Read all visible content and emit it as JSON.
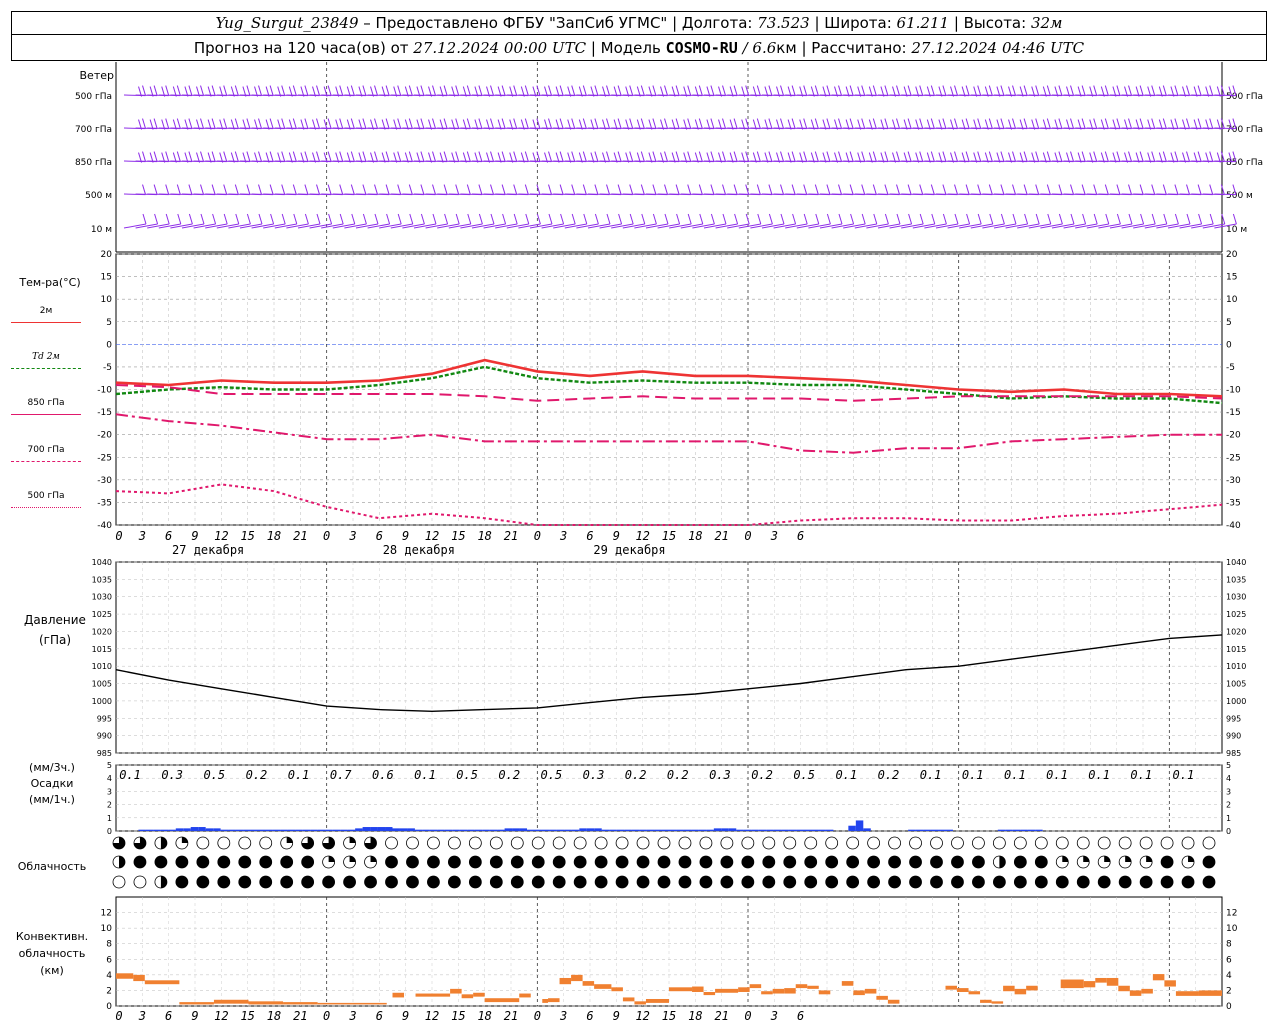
{
  "header": {
    "station": "Yug_Surgut_23849",
    "provider": " – Предоставлено ФГБУ \"ЗапСиб УГМС\" | Долгота: ",
    "lon": "73.523",
    "lat_label": " | Широта: ",
    "lat": "61.211",
    "height_label": " | Высота: ",
    "height": "32м",
    "forecast_label": "Прогноз на 120 часа(ов) от ",
    "forecast_time": "27.12.2024 00:00 UTC",
    "model_label": " | Модель ",
    "model": "COSMO-RU",
    "res": " / 6.6",
    "res_unit": "км",
    "computed_label": " | Рассчитано: ",
    "computed_time": "27.12.2024 04:46 UTC"
  },
  "labels": {
    "wind": "Ветер",
    "wind_levels": [
      "500 гПа",
      "700 гПа",
      "850 гПа",
      "500 м",
      "10 м"
    ],
    "temp": "Тем-ра(°С)",
    "legend": [
      "2м",
      "Td 2м",
      "850 гПа",
      "700 гПа",
      "500 гПа"
    ],
    "pressure": "Давление",
    "pressure_unit": "(гПа)",
    "precip_unit3": "(мм/3ч.)",
    "precip": "Осадки",
    "precip_unit1": "(мм/1ч.)",
    "cloud": "Облачность",
    "conv1": "Конвективн.",
    "conv2": "облачность",
    "conv_unit": "(км)"
  },
  "dates": [
    "27 декабря",
    "28 декабря",
    "29 декабря"
  ],
  "colors": {
    "t2m": "#ee3333",
    "td2m": "#118811",
    "t850": "#e0186c",
    "wind": "#8e2ee8",
    "precip": "#2244ee",
    "conv": "#f08030",
    "zero": "#4466ee"
  },
  "chart_data": [
    {
      "type": "line",
      "name": "temperature",
      "x_hours": [
        0,
        6,
        12,
        18,
        24,
        30,
        36,
        42,
        48,
        54,
        60,
        66,
        72,
        78,
        84,
        90,
        96,
        102,
        108,
        114,
        120,
        126
      ],
      "series": [
        {
          "name": "2м",
          "values": [
            -8.5,
            -9,
            -8,
            -8.5,
            -8.5,
            -8,
            -6.5,
            -3.5,
            -6,
            -7,
            -6,
            -7,
            -7,
            -7.5,
            -8,
            -9,
            -10,
            -10.5,
            -10,
            -11,
            -11,
            -11.5
          ]
        },
        {
          "name": "Td 2м",
          "values": [
            -11,
            -10,
            -9.5,
            -10,
            -10,
            -9,
            -7.5,
            -5,
            -7.5,
            -8.5,
            -8,
            -8.5,
            -8.5,
            -9,
            -9,
            -10,
            -11,
            -12,
            -11.5,
            -12,
            -12,
            -13
          ]
        },
        {
          "name": "850 гПа",
          "values": [
            -9,
            -9.5,
            -11,
            -11,
            -11,
            -11,
            -11,
            -11.5,
            -12.5,
            -12,
            -11.5,
            -12,
            -12,
            -12,
            -12.5,
            -12,
            -11.5,
            -11.5,
            -11.5,
            -11.5,
            -11.5,
            -12
          ]
        },
        {
          "name": "700 гПа",
          "values": [
            -15.5,
            -17,
            -18,
            -19.5,
            -21,
            -21,
            -20,
            -21.5,
            -21.5,
            -21.5,
            -21.5,
            -21.5,
            -21.5,
            -23.5,
            -24,
            -23,
            -23,
            -21.5,
            -21,
            -20.5,
            -20,
            -20
          ]
        },
        {
          "name": "500 гПа",
          "values": [
            -32.5,
            -33,
            -31,
            -32.5,
            -36,
            -38.5,
            -37.5,
            -38.5,
            -41,
            -42,
            -42,
            -42,
            -42,
            -39,
            -38.5,
            -38.5,
            -39,
            -39,
            -38,
            -37.5,
            -36.5,
            -35.5
          ]
        }
      ],
      "ylim": [
        -40,
        20
      ],
      "yticks": [
        -40,
        -35,
        -30,
        -25,
        -20,
        -15,
        -10,
        -5,
        0,
        5,
        10,
        15,
        20
      ]
    },
    {
      "type": "line",
      "name": "pressure",
      "x_hours": [
        0,
        6,
        12,
        18,
        24,
        30,
        36,
        42,
        48,
        54,
        60,
        66,
        72,
        78,
        84,
        90,
        96,
        102,
        108,
        114,
        120,
        126
      ],
      "values": [
        1009,
        1006,
        1003.5,
        1001,
        998.5,
        997.5,
        997,
        997.5,
        998,
        999.5,
        1001,
        1002,
        1003.5,
        1005,
        1007,
        1009,
        1010,
        1012,
        1014,
        1016,
        1018,
        1019
      ],
      "ylim": [
        985,
        1040
      ],
      "yticks": [
        985,
        990,
        995,
        1000,
        1005,
        1010,
        1015,
        1020,
        1025,
        1030,
        1035,
        1040
      ]
    },
    {
      "type": "bar",
      "name": "precipitation",
      "precip_3h": [
        "0.1",
        "0.3",
        "0.5",
        "0.2",
        "0.1",
        "0.7",
        "0.6",
        "0.1",
        "0.5",
        "0.2",
        "0.5",
        "0.3",
        "0.2",
        "0.2",
        "0.3",
        "0.2",
        "0.5",
        "0.1",
        "0.2",
        "0.1",
        "0.1",
        "0.1",
        "0.1",
        "0.1",
        "0.1",
        "0.1"
      ],
      "hourly": [
        0,
        0,
        0,
        0.1,
        0.1,
        0.1,
        0.1,
        0.1,
        0.2,
        0.2,
        0.3,
        0.3,
        0.2,
        0.2,
        0.1,
        0.1,
        0.1,
        0.1,
        0.1,
        0.1,
        0.1,
        0.1,
        0.1,
        0.1,
        0.1,
        0.1,
        0.1,
        0.1,
        0.1,
        0.1,
        0.1,
        0.1,
        0.2,
        0.3,
        0.3,
        0.3,
        0.3,
        0.2,
        0.2,
        0.2,
        0.1,
        0.1,
        0.1,
        0.1,
        0.1,
        0.1,
        0.1,
        0.1,
        0.1,
        0.1,
        0.1,
        0.1,
        0.2,
        0.2,
        0.2,
        0.1,
        0.1,
        0.1,
        0.1,
        0.1,
        0.1,
        0.1,
        0.2,
        0.2,
        0.2,
        0.1,
        0.1,
        0.1,
        0.1,
        0.1,
        0.1,
        0.1,
        0.1,
        0.1,
        0.1,
        0.1,
        0.1,
        0.1,
        0.1,
        0.1,
        0.2,
        0.2,
        0.2,
        0.1,
        0.1,
        0.1,
        0.1,
        0.1,
        0.1,
        0.1,
        0.1,
        0.1,
        0.1,
        0.1,
        0.1,
        0.1,
        0,
        0,
        0.4,
        0.8,
        0.2,
        0,
        0,
        0,
        0,
        0,
        0.1,
        0.1,
        0.1,
        0.1,
        0.1,
        0.1,
        0,
        0,
        0,
        0,
        0,
        0,
        0.1,
        0.1,
        0.1,
        0.1,
        0.1,
        0.1,
        0,
        0,
        0,
        0,
        0,
        0,
        0,
        0,
        0,
        0,
        0,
        0,
        0,
        0,
        0,
        0,
        0,
        0,
        0,
        0,
        0,
        0,
        0,
        0,
        0,
        0,
        0,
        0,
        0,
        0,
        0,
        0,
        0,
        0,
        0,
        0
      ],
      "ylim": [
        0,
        5
      ],
      "yticks": [
        0,
        1,
        2,
        3,
        4,
        5
      ]
    },
    {
      "type": "table",
      "name": "cloudiness",
      "rows": [
        [
          0.75,
          0.75,
          0.5,
          0.25,
          0,
          0,
          0,
          0,
          0.25,
          0.75,
          0.75,
          0.25,
          0.75,
          0,
          0,
          0,
          0,
          0,
          0,
          0,
          0,
          0,
          0,
          0,
          0,
          0,
          0,
          0,
          0,
          0,
          0,
          0,
          0,
          0,
          0,
          0,
          0,
          0,
          0,
          0,
          0,
          0,
          0,
          0,
          0,
          0,
          0,
          0,
          0,
          0,
          0,
          0,
          0,
          0,
          0,
          0,
          0,
          0,
          0,
          0,
          0,
          0,
          0,
          0,
          0,
          0,
          0,
          0,
          0,
          0,
          0,
          0,
          0,
          0,
          0,
          0,
          0,
          0,
          0,
          0,
          0,
          0,
          0,
          0
        ],
        [
          0.5,
          1,
          1,
          1,
          1,
          1,
          1,
          1,
          1,
          1,
          0.25,
          0.25,
          0.25,
          1,
          1,
          1,
          1,
          1,
          1,
          1,
          1,
          1,
          1,
          1,
          1,
          1,
          1,
          1,
          1,
          1,
          1,
          1,
          1,
          1,
          1,
          1,
          1,
          1,
          1,
          1,
          1,
          1,
          0.5,
          1,
          1,
          0.25,
          0.25,
          0.25,
          0.25,
          0.25,
          1,
          0.25,
          1,
          1,
          1,
          1,
          1,
          0.5,
          1,
          1,
          1,
          1,
          1,
          0.25,
          0.25,
          0.25,
          0.25,
          0.25,
          0.25,
          0.25,
          0.25,
          0.25,
          1,
          1,
          1,
          1,
          1,
          1,
          1,
          1,
          1,
          1,
          1,
          1,
          1,
          0.5,
          0,
          0,
          0,
          0,
          0,
          0,
          0,
          0,
          0,
          0,
          0,
          0,
          0,
          0
        ],
        [
          0,
          0,
          0.5,
          1,
          1,
          1,
          1,
          1,
          1,
          1,
          1,
          1,
          1,
          1,
          1,
          1,
          1,
          1,
          1,
          1,
          1,
          1,
          1,
          1,
          1,
          1,
          1,
          1,
          1,
          1,
          1,
          1,
          1,
          1,
          1,
          1,
          1,
          1,
          1,
          1,
          1,
          1,
          1,
          1,
          1,
          1,
          1,
          1,
          1,
          1,
          1,
          1,
          1,
          1,
          1,
          1,
          1,
          1,
          1,
          1,
          1,
          1,
          1,
          1,
          1,
          1,
          1,
          1,
          1,
          1,
          1,
          1,
          1,
          1,
          1,
          1,
          1,
          1,
          1,
          1,
          1,
          1,
          1,
          1,
          1,
          1,
          1,
          1,
          1,
          1,
          1,
          1,
          1,
          1,
          1,
          1,
          1,
          1,
          1,
          1,
          1,
          1,
          1,
          1
        ]
      ]
    },
    {
      "type": "bar",
      "name": "convective_cloudiness",
      "segments": [
        [
          0,
          1.5,
          3.5,
          4.2
        ],
        [
          1.5,
          2.5,
          3.2,
          4
        ],
        [
          2.5,
          5.5,
          2.8,
          3.3
        ],
        [
          5.5,
          8.5,
          0.2,
          0.5
        ],
        [
          8.5,
          11.5,
          0.3,
          0.8
        ],
        [
          11.5,
          14.5,
          0.2,
          0.6
        ],
        [
          14.5,
          17.5,
          0.2,
          0.5
        ],
        [
          17.5,
          23.5,
          0.2,
          0.4
        ],
        [
          24,
          25,
          1.1,
          1.7
        ],
        [
          26,
          29,
          1.2,
          1.6
        ],
        [
          29,
          30,
          1.6,
          2.2
        ],
        [
          30,
          31,
          1,
          1.5
        ],
        [
          31,
          32,
          1.2,
          1.7
        ],
        [
          32,
          35,
          0.5,
          1
        ],
        [
          35,
          36,
          1.1,
          1.6
        ],
        [
          37,
          37.5,
          0.4,
          0.9
        ],
        [
          37.5,
          38.5,
          0.5,
          1
        ],
        [
          38.5,
          39.5,
          2.8,
          3.6
        ],
        [
          39.5,
          40.5,
          3.2,
          4
        ],
        [
          40.5,
          41.5,
          2.6,
          3.2
        ],
        [
          41.5,
          43,
          2.2,
          2.8
        ],
        [
          43,
          44,
          1.9,
          2.4
        ],
        [
          44,
          45,
          0.6,
          1.1
        ],
        [
          45,
          46,
          0.2,
          0.6
        ],
        [
          46,
          48,
          0.4,
          0.9
        ],
        [
          48,
          50,
          1.9,
          2.4
        ],
        [
          50,
          51,
          1.8,
          2.5
        ],
        [
          51,
          52,
          1.4,
          1.8
        ],
        [
          52,
          54,
          1.7,
          2.2
        ],
        [
          54,
          55,
          1.8,
          2.4
        ],
        [
          55,
          56,
          2.3,
          2.8
        ],
        [
          56,
          57,
          1.5,
          1.9
        ],
        [
          57,
          58,
          1.6,
          2.2
        ],
        [
          58,
          59,
          1.6,
          2.3
        ],
        [
          59,
          60,
          2.3,
          2.8
        ],
        [
          60,
          61,
          2.2,
          2.6
        ],
        [
          61,
          62,
          1.5,
          2
        ],
        [
          63,
          64,
          2.6,
          3.2
        ],
        [
          64,
          65,
          1.4,
          2
        ],
        [
          65,
          66,
          1.6,
          2.2
        ],
        [
          66,
          67,
          0.8,
          1.3
        ],
        [
          67,
          68,
          0.3,
          0.8
        ],
        [
          72,
          73,
          2.1,
          2.6
        ],
        [
          73,
          74,
          1.8,
          2.3
        ],
        [
          74,
          75,
          1.5,
          1.9
        ],
        [
          75,
          76,
          0.4,
          0.8
        ],
        [
          76,
          77,
          0.3,
          0.6
        ],
        [
          77,
          78,
          1.9,
          2.6
        ],
        [
          78,
          79,
          1.5,
          2.2
        ],
        [
          79,
          80,
          2,
          2.6
        ],
        [
          82,
          84,
          2.3,
          3.4
        ],
        [
          84,
          85,
          2.4,
          3.2
        ],
        [
          85,
          86,
          3,
          3.6
        ],
        [
          86,
          87,
          2.6,
          3.6
        ],
        [
          87,
          88,
          1.9,
          2.6
        ],
        [
          88,
          89,
          1.3,
          2
        ],
        [
          89,
          90,
          1.6,
          2.2
        ],
        [
          90,
          91,
          3.3,
          4.1
        ],
        [
          91,
          92,
          2.5,
          3.3
        ],
        [
          92,
          94,
          1.3,
          1.9
        ],
        [
          94,
          96,
          1.3,
          2
        ]
      ],
      "ylim": [
        0,
        14
      ],
      "yticks": [
        0,
        2,
        4,
        6,
        8,
        10,
        12
      ]
    }
  ],
  "axis": {
    "hour_labels": [
      "0",
      "3",
      "6",
      "9",
      "12",
      "15",
      "18",
      "21",
      "0",
      "3",
      "6",
      "9",
      "12",
      "15",
      "18",
      "21",
      "0",
      "3",
      "6",
      "9",
      "12",
      "15",
      "18",
      "21",
      "0",
      "3",
      "6"
    ]
  }
}
